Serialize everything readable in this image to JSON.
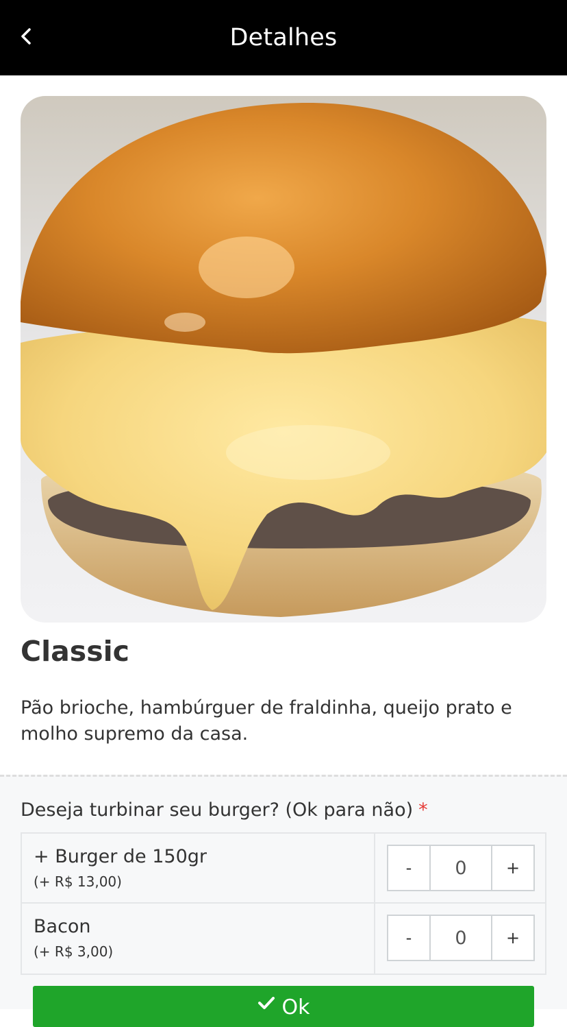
{
  "header": {
    "title": "Detalhes",
    "back_icon": "chevron-left-icon"
  },
  "product": {
    "image_alt": "burger-photo",
    "name": "Classic",
    "description": "Pão brioche, hambúrguer de fraldinha, queijo prato e molho supremo da casa."
  },
  "options": {
    "title": "Deseja turbinar seu burger? (Ok para não)",
    "required_mark": "*",
    "items": [
      {
        "name": "+ Burger de 150gr",
        "price": "(+ R$ 13,00)",
        "quantity": "0",
        "minus": "-",
        "plus": "+"
      },
      {
        "name": "Bacon",
        "price": "(+ R$ 3,00)",
        "quantity": "0",
        "minus": "-",
        "plus": "+"
      }
    ]
  },
  "confirm": {
    "label": "Ok",
    "icon": "check-icon"
  },
  "colors": {
    "header_bg": "#000000",
    "accent_green": "#1fa52a",
    "required_red": "#e53935",
    "options_bg": "#f7f8f9"
  }
}
